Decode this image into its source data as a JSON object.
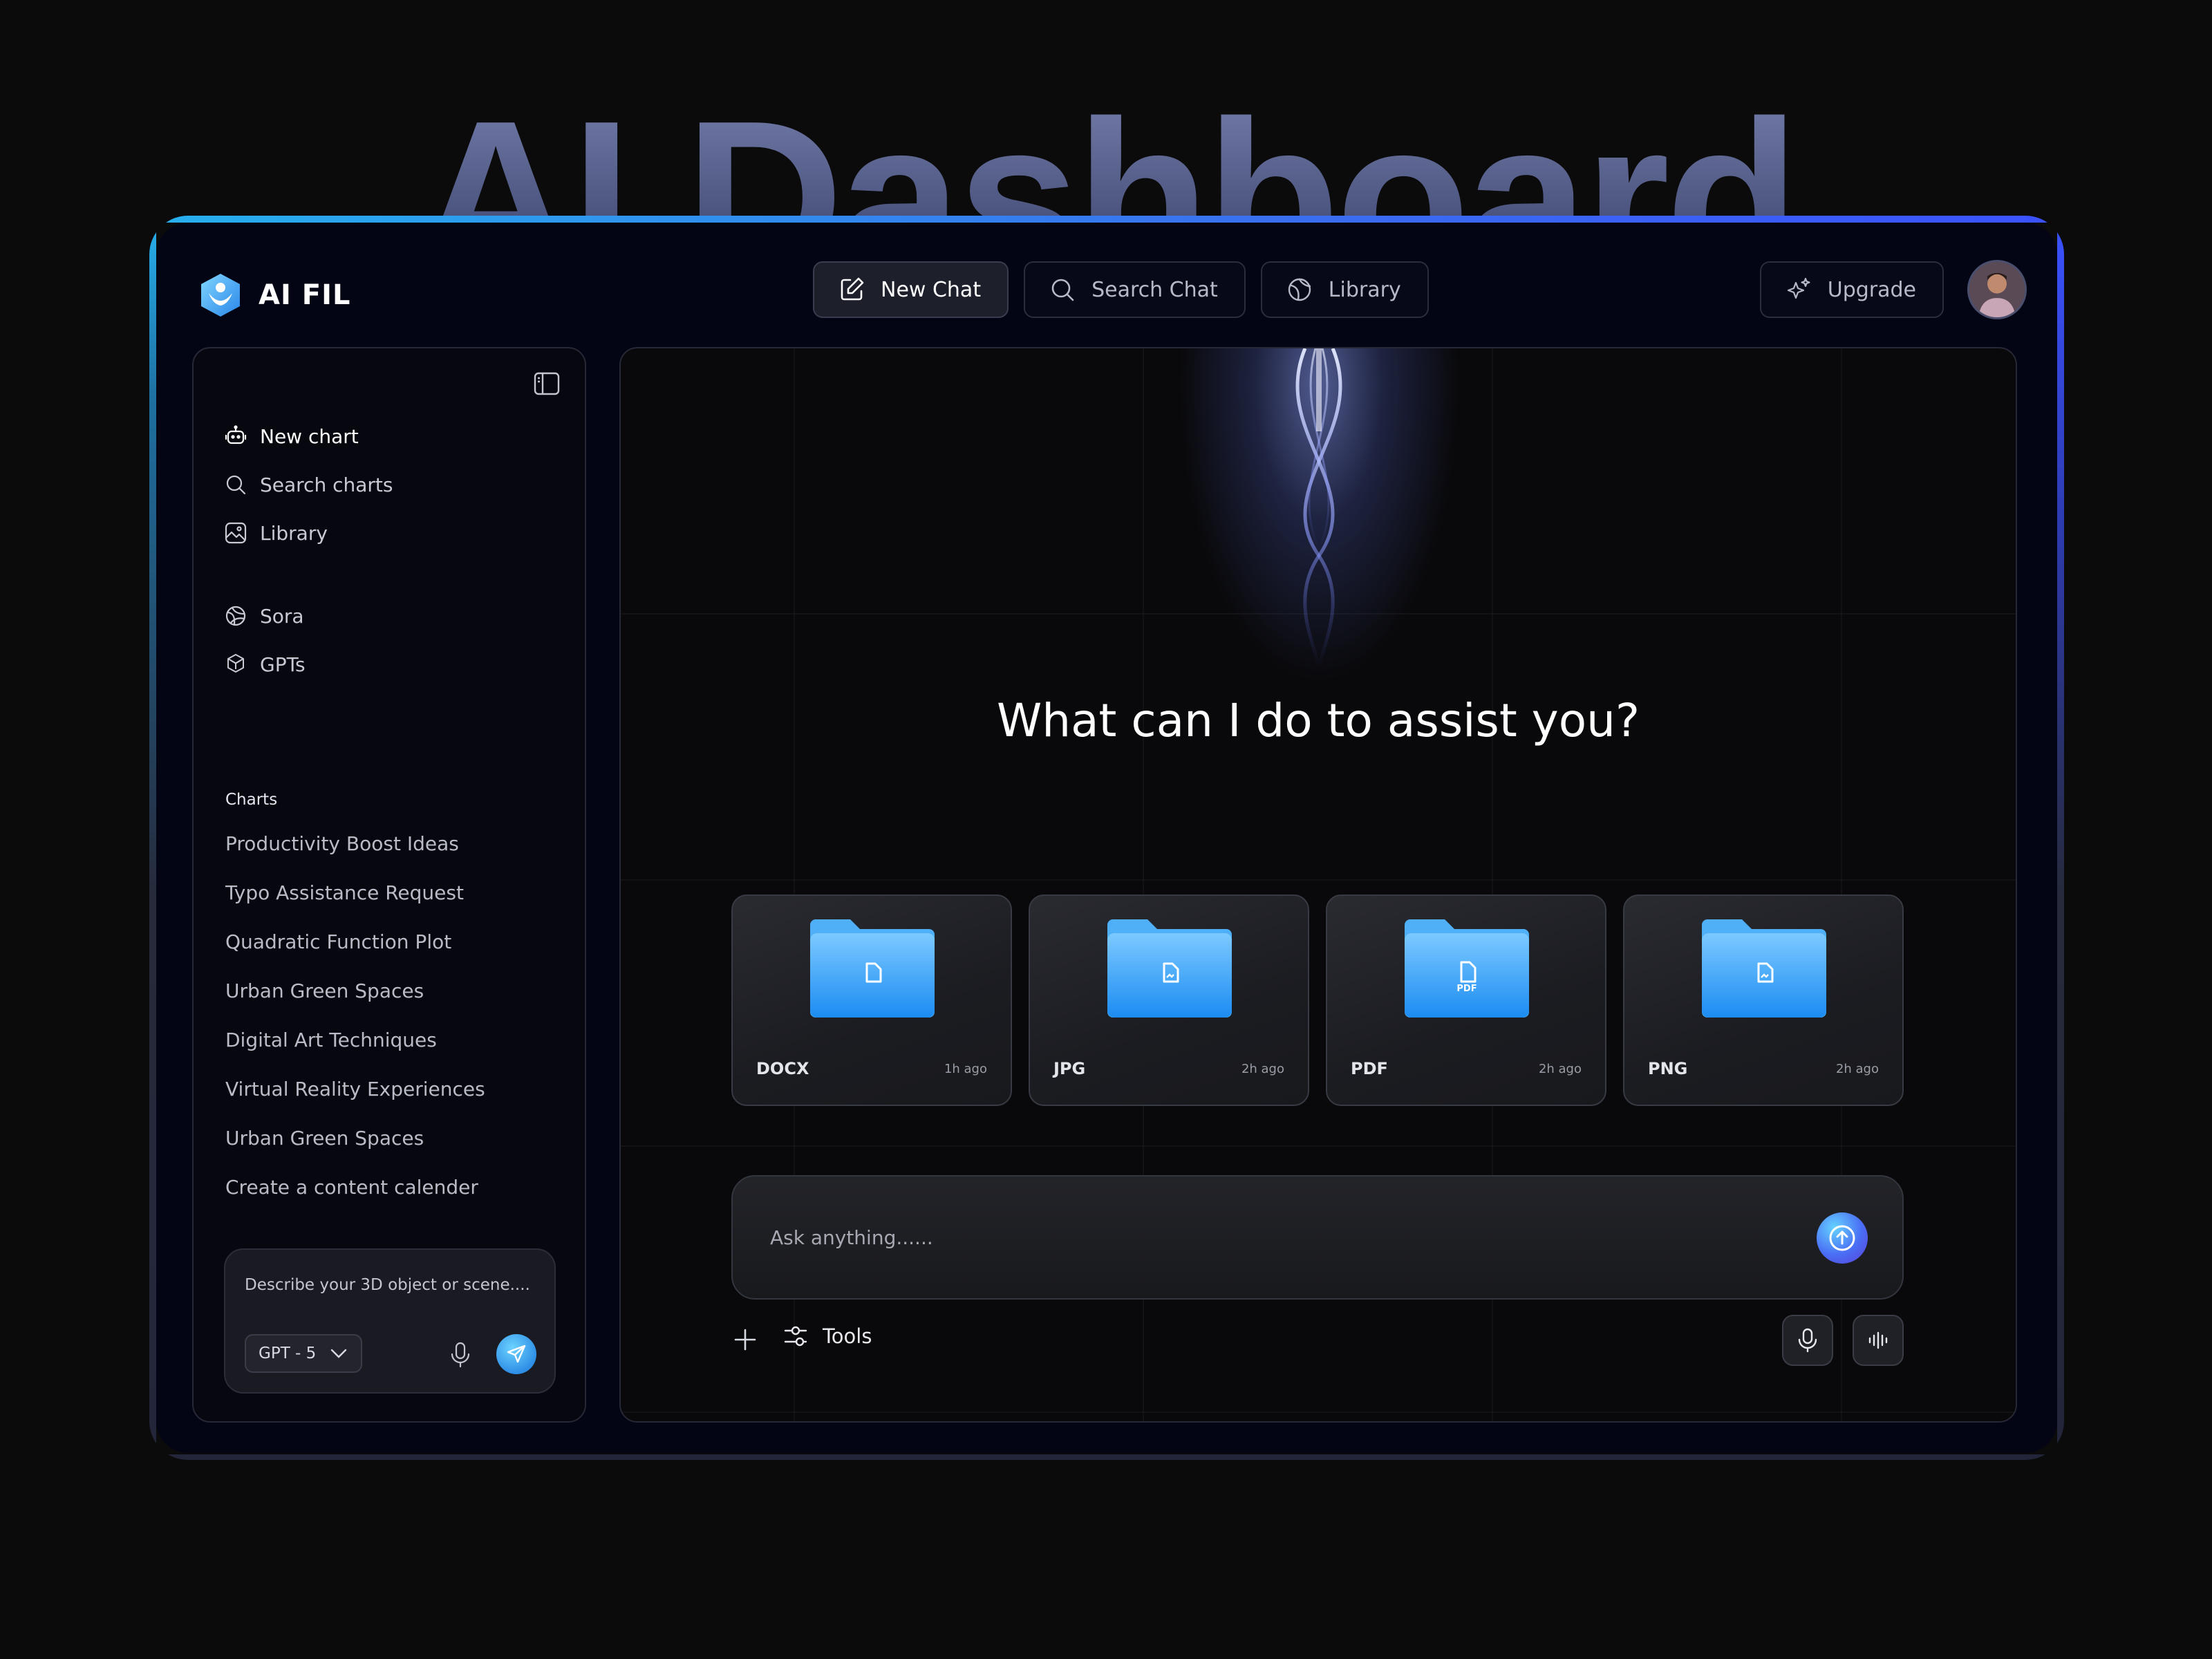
{
  "hero": {
    "title": "AI Dashboard"
  },
  "app": {
    "name": "AI FIL"
  },
  "topnav": {
    "new_chat": "New Chat",
    "search_chat": "Search Chat",
    "library": "Library",
    "upgrade": "Upgrade"
  },
  "sidebar": {
    "items": [
      {
        "label": "New chart",
        "icon": "bot-icon"
      },
      {
        "label": "Search charts",
        "icon": "search-icon"
      },
      {
        "label": "Library",
        "icon": "image-icon"
      },
      {
        "label": "Sora",
        "icon": "sora-icon"
      },
      {
        "label": "GPTs",
        "icon": "gpts-icon"
      }
    ],
    "section_title": "Charts",
    "charts": [
      "Productivity Boost Ideas",
      "Typo Assistance Request",
      "Quadratic Function Plot",
      "Urban Green Spaces",
      "Digital Art Techniques",
      "Virtual Reality Experiences",
      "Urban Green Spaces",
      "Create a content calender"
    ],
    "composer": {
      "placeholder": "Describe your 3D object or scene....",
      "model": "GPT - 5"
    }
  },
  "main": {
    "headline": "What can I do to assist you?",
    "files": [
      {
        "name": "DOCX",
        "time": "1h ago",
        "badge": ""
      },
      {
        "name": "JPG",
        "time": "2h ago",
        "badge": ""
      },
      {
        "name": "PDF",
        "time": "2h ago",
        "badge": "PDF"
      },
      {
        "name": "PNG",
        "time": "2h ago",
        "badge": ""
      }
    ],
    "ask_placeholder": "Ask anything......",
    "tools_label": "Tools"
  },
  "colors": {
    "accent_blue": "#2f8fe6",
    "folder_blue": "#3aa6f5",
    "frame_cyan": "#27b0ee",
    "frame_indigo": "#3b52ff"
  }
}
